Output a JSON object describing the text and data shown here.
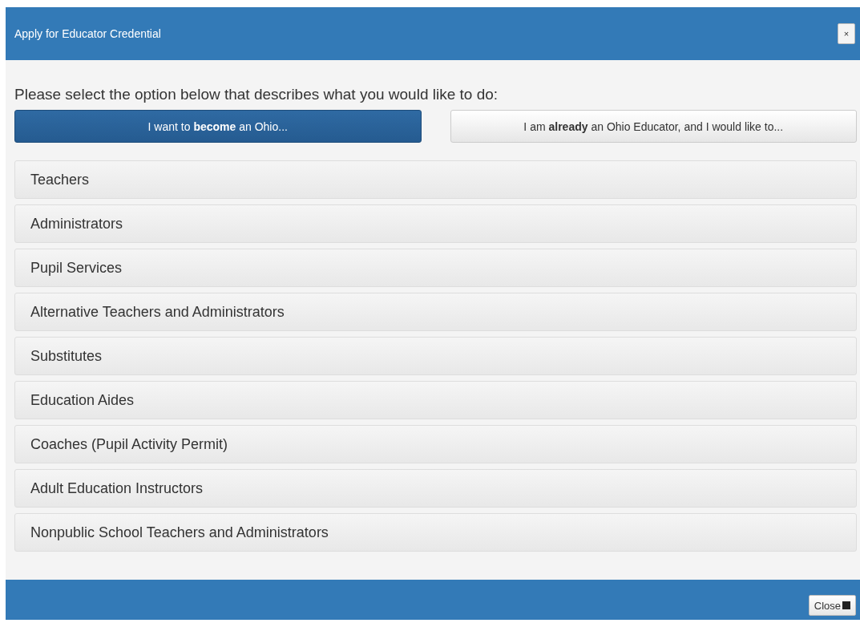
{
  "dialog": {
    "title": "Apply for Educator Credential",
    "close_icon": "×"
  },
  "prompt": "Please select the option below that describes what you would like to do:",
  "choices": [
    {
      "label": "I want to **become** an Ohio...",
      "selected": true
    },
    {
      "label": "I am **already** an Ohio Educator, and I would like to...",
      "selected": false
    }
  ],
  "options": [
    {
      "label": "Teachers"
    },
    {
      "label": "Administrators"
    },
    {
      "label": "Pupil Services"
    },
    {
      "label": "Alternative Teachers and Administrators"
    },
    {
      "label": "Substitutes"
    },
    {
      "label": "Education Aides"
    },
    {
      "label": "Coaches (Pupil Activity Permit)"
    },
    {
      "label": "Adult Education Instructors"
    },
    {
      "label": "Nonpublic School Teachers and Administrators"
    }
  ],
  "footer": {
    "close_button": "Close"
  }
}
